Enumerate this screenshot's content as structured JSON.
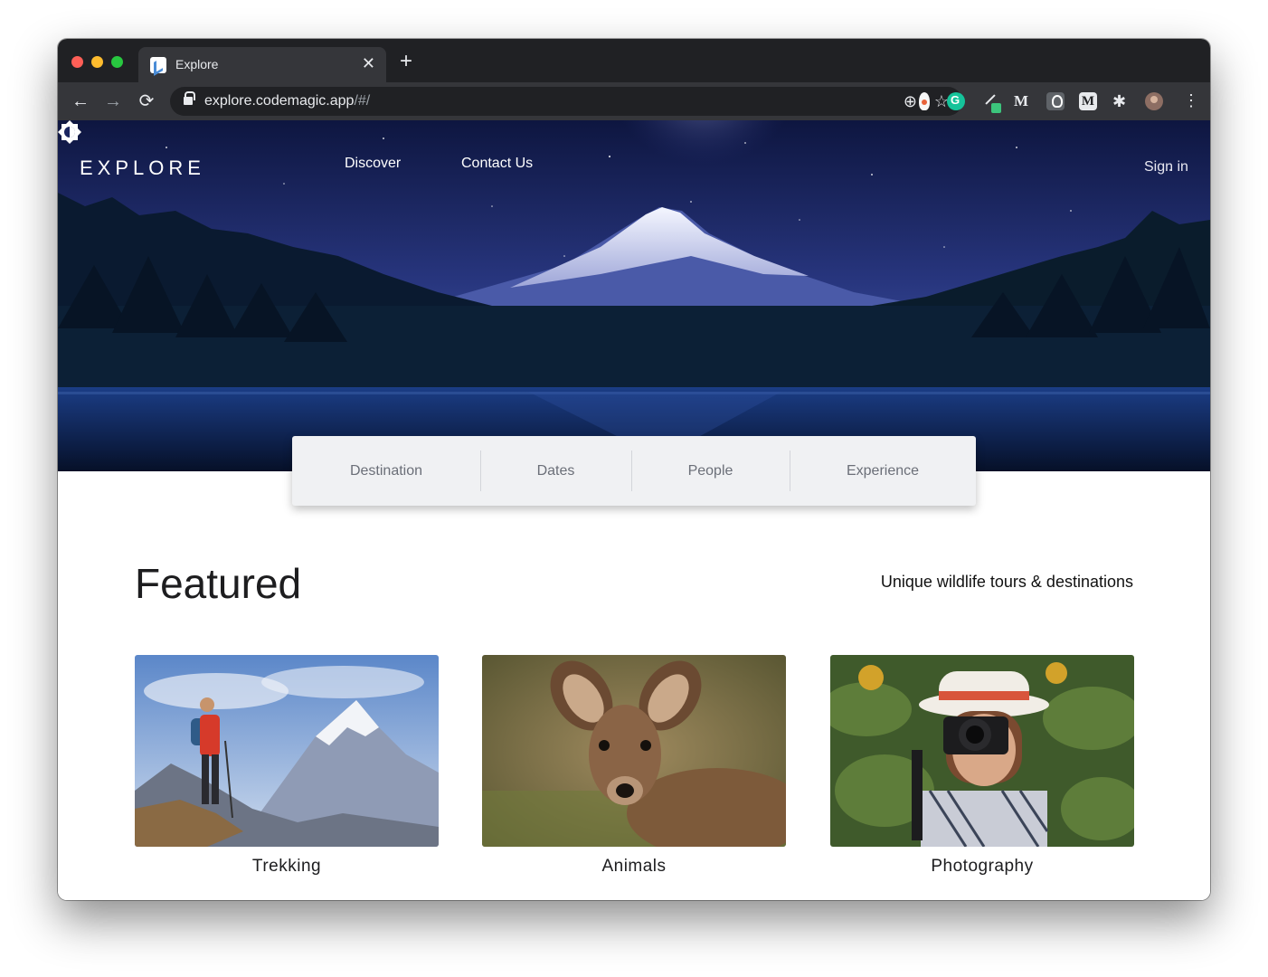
{
  "browser": {
    "tab_title": "Explore",
    "tab_close": "✕",
    "new_tab": "+",
    "url_host": "explore.codemagic.app",
    "url_path": "/#/",
    "back": "←",
    "forward": "→",
    "reload": "⟳",
    "zoom_icon": "⊕",
    "bookmark_icon": "☆",
    "ext_medium": "M",
    "ext_medium2": "M",
    "ext_puzzle": "✱",
    "menu": "⋮"
  },
  "header": {
    "brand": "EXPLORE",
    "nav": [
      "Discover",
      "Contact Us"
    ],
    "sign_in": "Sign in"
  },
  "search": {
    "fields": [
      "Destination",
      "Dates",
      "People",
      "Experience"
    ]
  },
  "featured": {
    "title": "Featured",
    "subtitle": "Unique wildlife tours & destinations",
    "cards": [
      {
        "label": "Trekking",
        "image": "hiker-mountains-photo"
      },
      {
        "label": "Animals",
        "image": "deer-photo"
      },
      {
        "label": "Photography",
        "image": "photographer-photo"
      }
    ]
  },
  "colors": {
    "chrome_dark": "#202124",
    "chrome_toolbar": "#35363a",
    "search_bg": "#f0f1f3",
    "search_text": "#6b6f78"
  }
}
